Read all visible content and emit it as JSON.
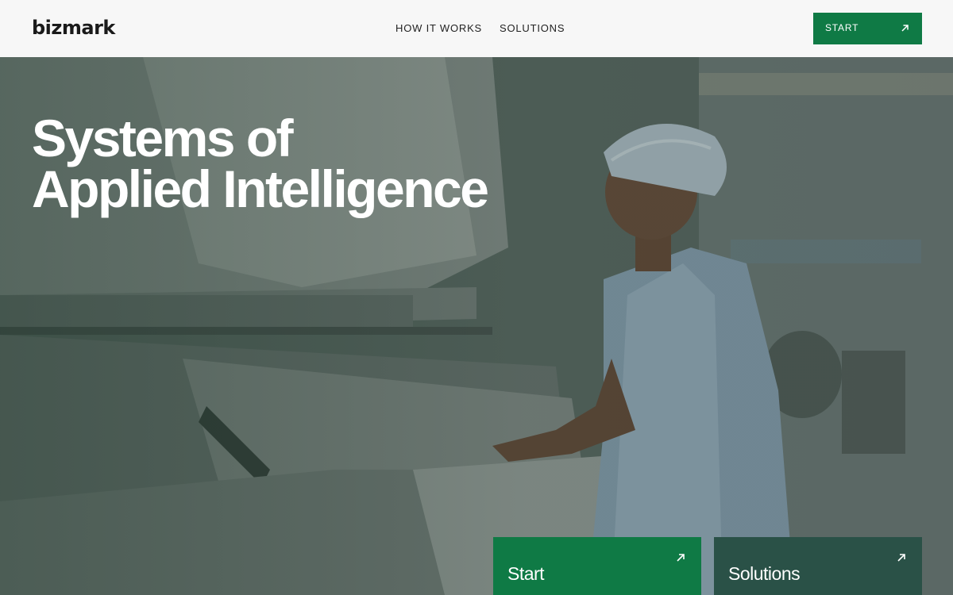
{
  "header": {
    "logo": "bizmark",
    "nav": [
      {
        "label": "HOW IT WORKS"
      },
      {
        "label": "SOLUTIONS"
      }
    ],
    "cta_label": "START",
    "cta_icon": "arrow-up-right-icon"
  },
  "hero": {
    "headline_line1": "Systems of",
    "headline_line2": "Applied Intelligence",
    "cards": [
      {
        "title": "Start",
        "icon": "arrow-up-right-icon"
      },
      {
        "title": "Solutions",
        "icon": "arrow-up-right-icon"
      }
    ]
  },
  "colors": {
    "accent": "#0f7a45",
    "accent_dark": "#2a5147",
    "header_bg": "#f7f7f7"
  }
}
